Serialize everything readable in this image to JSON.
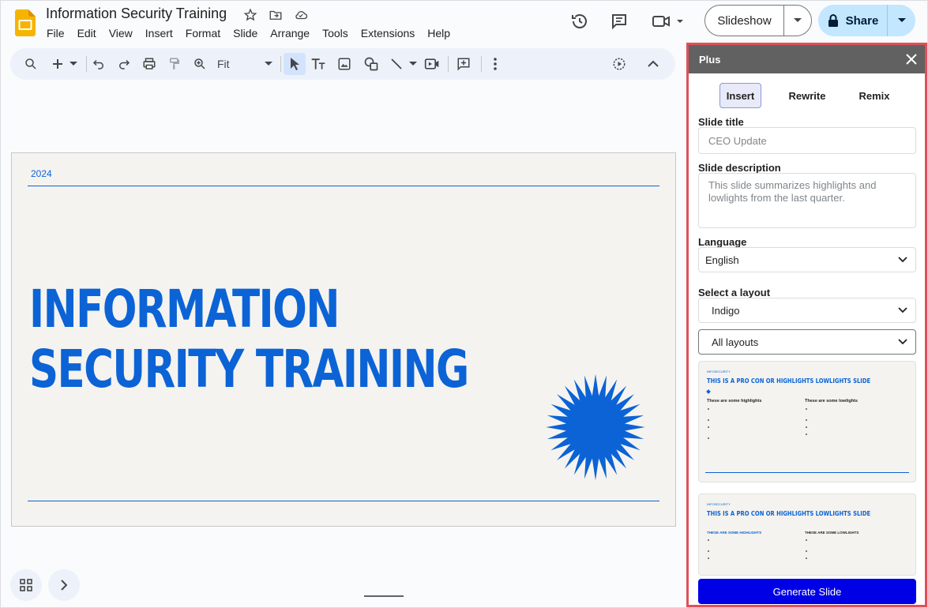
{
  "app": {
    "doc_title": "Information Security Training",
    "menu": [
      "File",
      "Edit",
      "View",
      "Insert",
      "Format",
      "Slide",
      "Arrange",
      "Tools",
      "Extensions",
      "Help"
    ],
    "slideshow_label": "Slideshow",
    "share_label": "Share"
  },
  "toolbar": {
    "zoom_value": "Fit"
  },
  "slide": {
    "year": "2024",
    "title_line1": "INFORMATION",
    "title_line2": "SECURITY TRAINING",
    "accent_color": "#0b63d6",
    "background_color": "#f4f3ef"
  },
  "panel": {
    "title": "Plus",
    "tabs": [
      {
        "label": "Insert",
        "active": true
      },
      {
        "label": "Rewrite",
        "active": false
      },
      {
        "label": "Remix",
        "active": false
      }
    ],
    "slide_title_label": "Slide title",
    "slide_title_placeholder": "CEO Update",
    "slide_description_label": "Slide description",
    "slide_description_placeholder": "This slide summarizes highlights and lowlights from the last quarter.",
    "language_label": "Language",
    "language_value": "English",
    "layout_label": "Select a layout",
    "layout_value": "Indigo",
    "filter_value": "All layouts",
    "generate_label": "Generate Slide",
    "generate_color": "#0000e6",
    "thumbnails": [
      {
        "small": "INFOSECURITY",
        "title": "THIS IS A PRO CON OR HIGHLIGHTS LOWLIGHTS SLIDE",
        "left_heading": "These are some highlights",
        "right_heading": "These are some lowlights"
      },
      {
        "small": "INFOSECURITY",
        "title": "THIS IS A PRO CON OR HIGHLIGHTS LOWLIGHTS SLIDE",
        "left_heading": "THESE ARE SOME HIGHLIGHTS",
        "right_heading": "THESE ARE SOME LOWLIGHTS"
      }
    ]
  }
}
